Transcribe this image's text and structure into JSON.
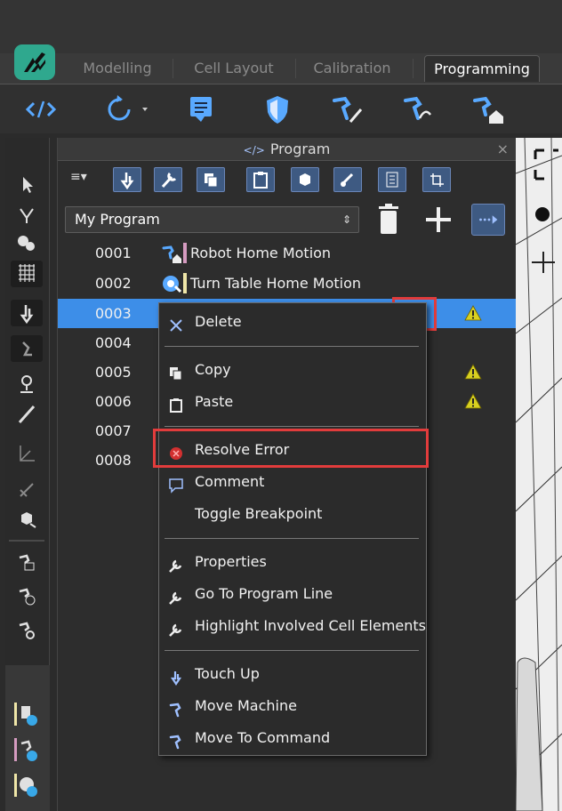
{
  "tabs": [
    {
      "label": "Modelling",
      "active": false
    },
    {
      "label": "Cell Layout",
      "active": false
    },
    {
      "label": "Calibration",
      "active": false
    },
    {
      "label": "Programming",
      "active": true
    }
  ],
  "ribbon_icons": [
    "code-icon",
    "rotate-dropdown-icon",
    "comment-icon",
    "shield-icon",
    "robot-edit-icon",
    "robot-path-icon",
    "robot-home-icon"
  ],
  "left_tool_icons": [
    "pointer-icon",
    "gripper-icon",
    "paint-icon",
    "grid-icon",
    "touch-icon",
    "touch-alt-icon",
    "location-icon",
    "ruler-icon",
    "axis-icon",
    "measure-icon",
    "cube-icon",
    "robot-frame-icon",
    "robot-target-icon",
    "robot-view-icon"
  ],
  "panel": {
    "title": "Program",
    "title_glyph": "</>",
    "close": "×",
    "menu_toggle": "≡▾",
    "toolbar_icons": [
      "touch-icon",
      "wrench-icon",
      "copy-icon",
      "paste-icon",
      "cube-icon",
      "paint-icon",
      "list-icon",
      "frame-icon"
    ]
  },
  "program_select": {
    "value": "My Program",
    "arrows": "⇕"
  },
  "rows": [
    {
      "num": "0001",
      "label": "Robot Home Motion",
      "icon": "robot-home-icon",
      "bar_color": "#d59bc0",
      "warning": false
    },
    {
      "num": "0002",
      "label": "Turn Table Home Motion",
      "icon": "turntable-icon",
      "bar_color": "#efe6a8",
      "warning": false
    },
    {
      "num": "0003",
      "label": "",
      "icon": "",
      "bar_color": "",
      "warning": true,
      "selected": true
    },
    {
      "num": "0004",
      "label": "",
      "icon": "",
      "bar_color": "",
      "warning": false
    },
    {
      "num": "0005",
      "label": "",
      "icon": "",
      "bar_color": "",
      "warning": true
    },
    {
      "num": "0006",
      "label": "",
      "icon": "",
      "bar_color": "",
      "warning": true
    },
    {
      "num": "0007",
      "label": "",
      "icon": "",
      "bar_color": "",
      "warning": false
    },
    {
      "num": "0008",
      "label": "",
      "icon": "",
      "bar_color": "",
      "warning": false
    }
  ],
  "context_menu": {
    "items": [
      {
        "label": "Delete",
        "icon": "close-icon"
      },
      {
        "label": "Copy",
        "icon": "copy-icon"
      },
      {
        "label": "Paste",
        "icon": "paste-icon"
      },
      {
        "label": "Resolve Error",
        "icon": "error-icon"
      },
      {
        "label": "Comment",
        "icon": "comment-icon"
      },
      {
        "label": "Toggle Breakpoint",
        "icon": ""
      },
      {
        "label": "Properties",
        "icon": "wrench-icon"
      },
      {
        "label": "Go To Program Line",
        "icon": "wrench-icon"
      },
      {
        "label": "Highlight Involved Cell Elements",
        "icon": "wrench-icon"
      },
      {
        "label": "Touch Up",
        "icon": "touch-icon"
      },
      {
        "label": "Move Machine",
        "icon": "robot-arm-icon"
      },
      {
        "label": "Move To Command",
        "icon": "robot-arm-icon"
      }
    ]
  },
  "colors": {
    "accent": "#3d8ee8",
    "highlight_border": "#e23c3c",
    "warning": "#d8d020",
    "error": "#d23030",
    "logo": "#2fa88e"
  }
}
